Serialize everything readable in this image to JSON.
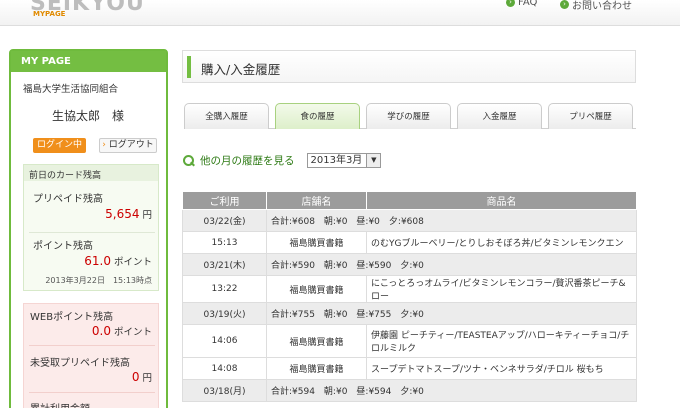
{
  "header": {
    "logo": "SEIKYOU",
    "logo_sub": "MYPAGE",
    "links": [
      {
        "label": "FAQ"
      },
      {
        "label": "お問い合わせ"
      }
    ]
  },
  "sidebar": {
    "title": "MY PAGE",
    "org": "福島大学生活協同組合",
    "user_name": "生協太郎　様",
    "login_status": "ログイン中",
    "logout": "ログアウト",
    "card": {
      "head": "前日のカード残高",
      "prepaid_label": "プリペイド残高",
      "prepaid_value": "5,654",
      "prepaid_unit": "円",
      "point_label": "ポイント残高",
      "point_value": "61.0",
      "point_unit": "ポイント",
      "as_of": "2013年3月22日　15:13時点"
    },
    "extra": {
      "web_point_label": "WEBポイント残高",
      "web_point_value": "0.0",
      "web_point_unit": "ポイント",
      "unreceived_label": "未受取プリペイド残高",
      "unreceived_value": "0",
      "unreceived_unit": "円",
      "total_label": "累計利用金額"
    }
  },
  "main": {
    "title": "購入/入金履歴",
    "tabs": [
      "全購入履歴",
      "食の履歴",
      "学びの履歴",
      "入金履歴",
      "プリペ履歴"
    ],
    "active_tab": 1,
    "month_label": "他の月の履歴を見る",
    "month_value": "2013年3月",
    "table": {
      "headers": [
        "ご利用",
        "店舗名",
        "商品名"
      ],
      "rows": [
        {
          "type": "day",
          "date": "03/22(金)",
          "summary": "合計:¥608　朝:¥0　昼:¥0　夕:¥608"
        },
        {
          "type": "tx",
          "time": "15:13",
          "store": "福島購買書籍",
          "items": "のむYGブルーベリー/とりしおそぼろ丼/ビタミンレモンクエン"
        },
        {
          "type": "day",
          "date": "03/21(木)",
          "summary": "合計:¥590　朝:¥0　昼:¥590　夕:¥0"
        },
        {
          "type": "tx",
          "time": "13:22",
          "store": "福島購買書籍",
          "items": "にこっとろっオムライ/ビタミンレモンコラー/贅沢番茶ピーチ&ロー"
        },
        {
          "type": "day",
          "date": "03/19(火)",
          "summary": "合計:¥755　朝:¥0　昼:¥755　夕:¥0"
        },
        {
          "type": "tx",
          "tall": true,
          "time": "14:06",
          "store": "福島購買書籍",
          "items": "伊藤園 ピーチティー/TEASTEAアップ/ハローキティーチョコ/チロルミルク"
        },
        {
          "type": "tx",
          "time": "14:08",
          "store": "福島購買書籍",
          "items": "スープデトマトスープ/ツナ・ベンネサラダ/チロル 桜もち"
        },
        {
          "type": "day",
          "date": "03/18(月)",
          "summary": "合計:¥594　朝:¥0　昼:¥594　夕:¥0"
        }
      ]
    }
  },
  "colors": {
    "accent_green": "#74be42",
    "orange": "#f08f1b",
    "value_red": "#cc0000",
    "table_header": "#9c9c9c"
  }
}
